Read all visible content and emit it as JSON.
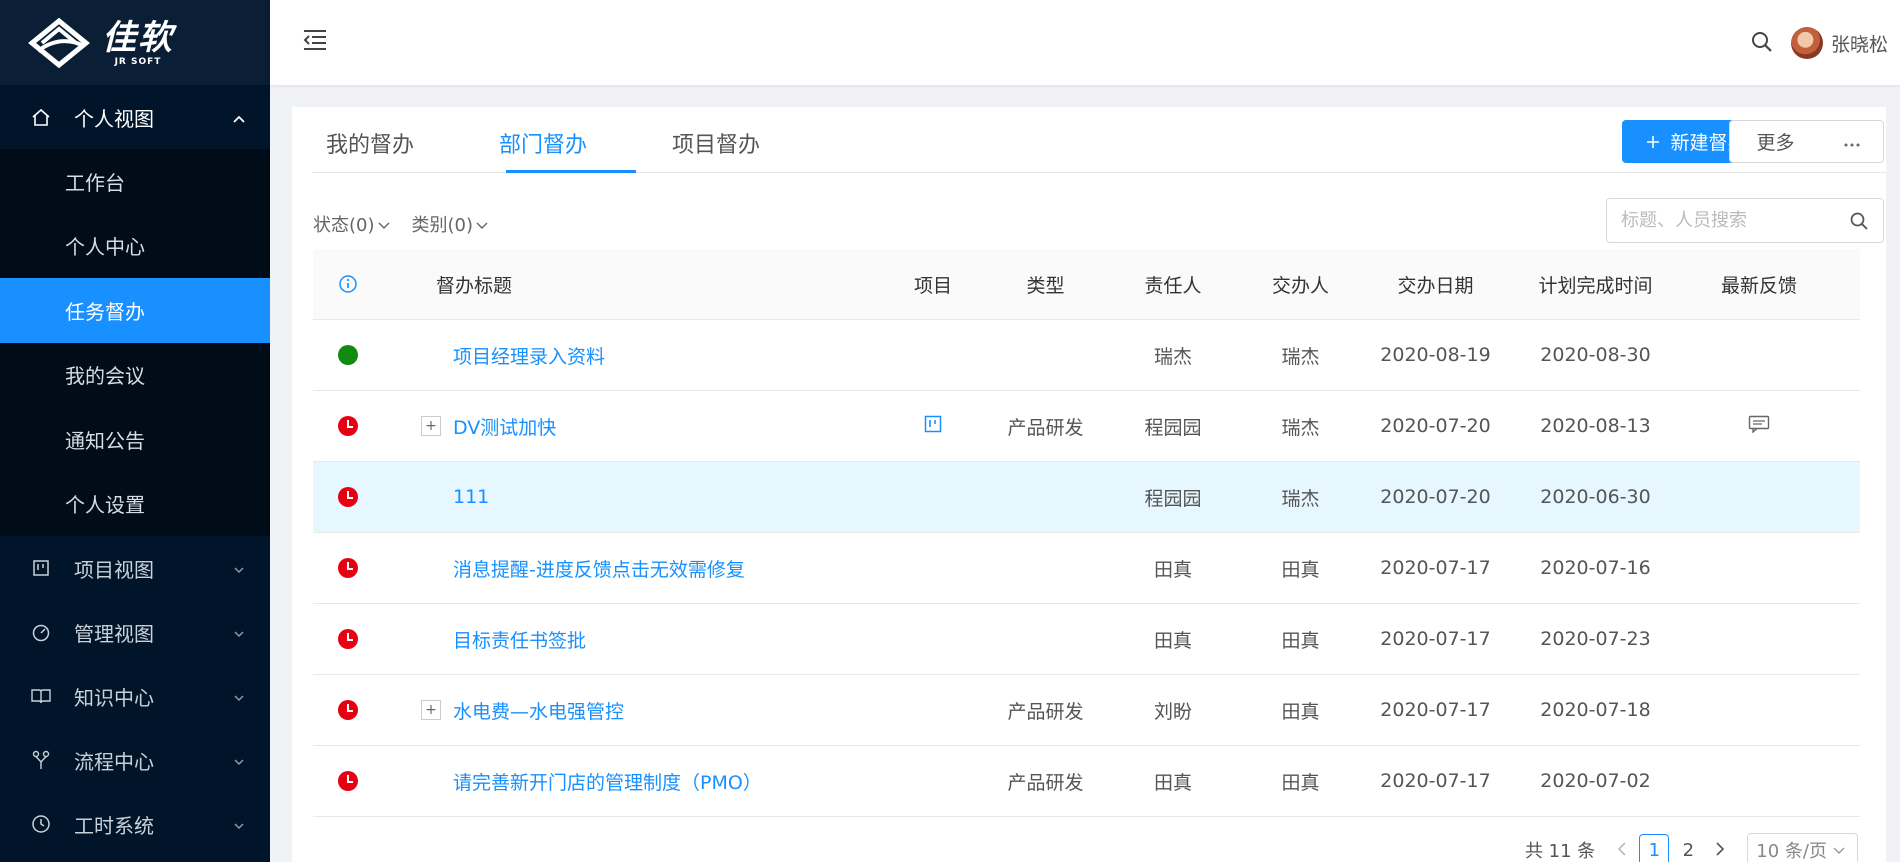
{
  "app": {
    "logo_cn": "佳软",
    "logo_en": "JR SOFT",
    "logo_jr": "JR"
  },
  "sidebar": {
    "groups": [
      {
        "label": "个人视图",
        "icon": "home-icon",
        "expanded": true,
        "items": [
          {
            "label": "工作台"
          },
          {
            "label": "个人中心"
          },
          {
            "label": "任务督办",
            "active": true
          },
          {
            "label": "我的会议"
          },
          {
            "label": "通知公告"
          },
          {
            "label": "个人设置"
          }
        ]
      },
      {
        "label": "项目视图",
        "icon": "project-icon"
      },
      {
        "label": "管理视图",
        "icon": "dashboard-icon"
      },
      {
        "label": "知识中心",
        "icon": "book-icon"
      },
      {
        "label": "流程中心",
        "icon": "flow-icon"
      },
      {
        "label": "工时系统",
        "icon": "clock-icon"
      }
    ]
  },
  "header": {
    "user_name": "张晓松"
  },
  "tabs": [
    {
      "label": "我的督办"
    },
    {
      "label": "部门督办",
      "active": true
    },
    {
      "label": "项目督办"
    }
  ],
  "toolbar": {
    "new_label": "新建督办",
    "more_label": "更多"
  },
  "filters": {
    "status": "状态(0)",
    "category": "类别(0)"
  },
  "search": {
    "placeholder": "标题、人员搜索"
  },
  "table": {
    "headers": {
      "title": "督办标题",
      "project": "项目",
      "type": "类型",
      "owner": "责任人",
      "assigner": "交办人",
      "assign_date": "交办日期",
      "plan_date": "计划完成时间",
      "feedback": "最新反馈"
    },
    "rows": [
      {
        "status": "green",
        "title": "项目经理录入资料",
        "expandable": false,
        "project_icon": false,
        "type": "",
        "owner": "瑞杰",
        "assigner": "瑞杰",
        "assign_date": "2020-08-19",
        "plan_date": "2020-08-30",
        "feedback_icon": false
      },
      {
        "status": "red",
        "title": "DV测试加快",
        "expandable": true,
        "project_icon": true,
        "type": "产品研发",
        "owner": "程园园",
        "assigner": "瑞杰",
        "assign_date": "2020-07-20",
        "plan_date": "2020-08-13",
        "feedback_icon": true
      },
      {
        "status": "red",
        "title": "111",
        "expandable": false,
        "project_icon": false,
        "type": "",
        "owner": "程园园",
        "assigner": "瑞杰",
        "assign_date": "2020-07-20",
        "plan_date": "2020-06-30",
        "feedback_icon": false,
        "highlighted": true
      },
      {
        "status": "red",
        "title": "消息提醒-进度反馈点击无效需修复",
        "expandable": false,
        "project_icon": false,
        "type": "",
        "owner": "田真",
        "assigner": "田真",
        "assign_date": "2020-07-17",
        "plan_date": "2020-07-16",
        "feedback_icon": false
      },
      {
        "status": "red",
        "title": "目标责任书签批",
        "expandable": false,
        "project_icon": false,
        "type": "",
        "owner": "田真",
        "assigner": "田真",
        "assign_date": "2020-07-17",
        "plan_date": "2020-07-23",
        "feedback_icon": false
      },
      {
        "status": "red",
        "title": "水电费—水电强管控",
        "expandable": true,
        "project_icon": false,
        "type": "产品研发",
        "owner": "刘盼",
        "assigner": "田真",
        "assign_date": "2020-07-17",
        "plan_date": "2020-07-18",
        "feedback_icon": false
      },
      {
        "status": "red",
        "title": "请完善新开门店的管理制度（PMO）",
        "expandable": false,
        "project_icon": false,
        "type": "产品研发",
        "owner": "田真",
        "assigner": "田真",
        "assign_date": "2020-07-17",
        "plan_date": "2020-07-02",
        "feedback_icon": false
      }
    ]
  },
  "pagination": {
    "total": "共 11 条",
    "pages": [
      "1",
      "2"
    ],
    "current": "1",
    "page_size": "10 条/页"
  },
  "colors": {
    "primary": "#1890ff",
    "sidebar_bg": "#001529",
    "status_green": "#108b10",
    "status_red": "#e60012"
  }
}
